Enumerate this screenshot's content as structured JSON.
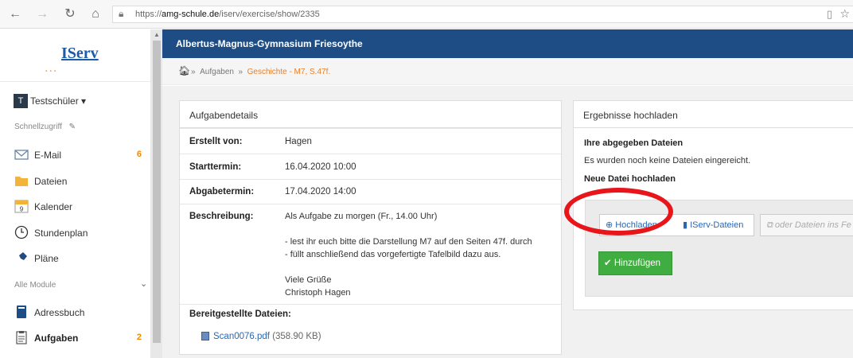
{
  "browser": {
    "url_prefix": "https://",
    "url_host": "amg-schule.de",
    "url_path": "/iserv/exercise/show/2335"
  },
  "sidebar": {
    "logo_text": "IServ",
    "logo_dots": "...",
    "user_initial": "T",
    "user_name": "Testschüler ▾",
    "quick_access_title": "Schnellzugriff",
    "quick_items": [
      {
        "label": "E-Mail",
        "badge": "6",
        "icon": "mail-icon"
      },
      {
        "label": "Dateien",
        "badge": "",
        "icon": "folder-icon"
      },
      {
        "label": "Kalender",
        "badge": "",
        "icon": "calendar-icon"
      },
      {
        "label": "Stundenplan",
        "badge": "",
        "icon": "clock-icon"
      },
      {
        "label": "Pläne",
        "badge": "",
        "icon": "pin-icon"
      }
    ],
    "modules_title": "Alle Module",
    "module_items": [
      {
        "label": "Adressbuch",
        "badge": "",
        "icon": "addressbook-icon"
      },
      {
        "label": "Aufgaben",
        "badge": "2",
        "icon": "clipboard-icon"
      }
    ]
  },
  "header": {
    "school_name": "Albertus-Magnus-Gymnasium Friesoythe"
  },
  "breadcrumb": {
    "sep": "»",
    "item1": "Aufgaben",
    "current": "Geschichte - M7, S.47f."
  },
  "details": {
    "panel_title": "Aufgabendetails",
    "created_by_label": "Erstellt von:",
    "created_by": "Hagen",
    "start_label": "Starttermin:",
    "start": "16.04.2020 10:00",
    "due_label": "Abgabetermin:",
    "due": "17.04.2020 14:00",
    "desc_label": "Beschreibung:",
    "desc_lines": [
      "Als Aufgabe zu morgen (Fr., 14.00 Uhr)",
      "",
      "- lest ihr euch bitte die Darstellung M7 auf den Seiten 47f. durch",
      "- füllt anschließend das vorgefertigte Tafelbild dazu aus.",
      "",
      "Viele Grüße",
      "Christoph Hagen"
    ],
    "files_label": "Bereitgestellte Dateien:",
    "file_name": "Scan0076.pdf",
    "file_size": "(358.90 KB)"
  },
  "upload": {
    "panel_title": "Ergebnisse hochladen",
    "submitted_heading": "Ihre abgegeben Dateien",
    "submitted_text": "Es wurden noch keine Dateien eingereicht.",
    "new_heading": "Neue Datei hochladen",
    "btn_upload": "Hochladen",
    "btn_iserv": "IServ-Dateien",
    "btn_drop": "oder Dateien ins Fe",
    "btn_add": "Hinzufügen"
  },
  "colors": {
    "header_bg": "#1d4d84",
    "badge": "#f08a00",
    "add_button": "#3fad3f",
    "highlight_ring": "#e8151b"
  }
}
